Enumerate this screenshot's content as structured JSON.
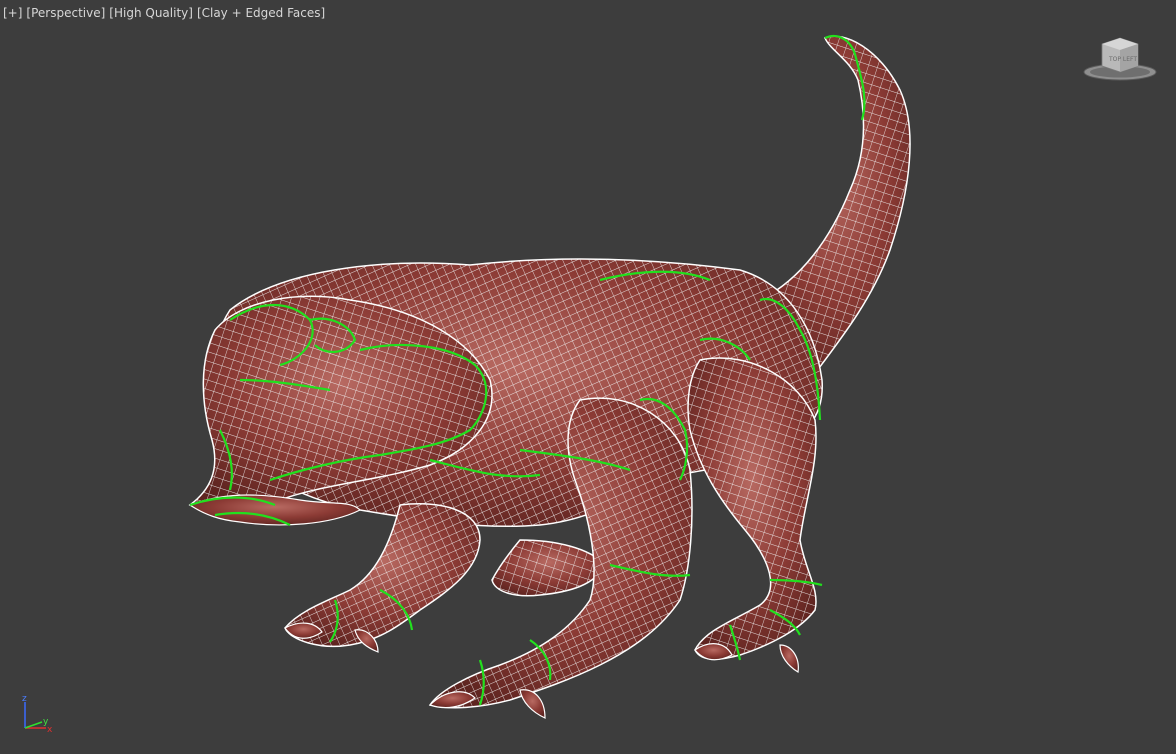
{
  "viewport": {
    "labels": [
      "[+]",
      "[Perspective]",
      "[High Quality]",
      "[Clay + Edged Faces]"
    ],
    "viewcube_face": "TOP LEFT",
    "axis": {
      "x": "x",
      "y": "y",
      "z": "z"
    }
  },
  "colors": {
    "background": "#3d3d3d",
    "clay": "#8a3a34",
    "clay_highlight": "#b05a52",
    "wire": "#ffffff",
    "selection_edges": "#22e01e"
  },
  "icons": [
    "viewcube-icon",
    "axis-tripod-icon"
  ]
}
